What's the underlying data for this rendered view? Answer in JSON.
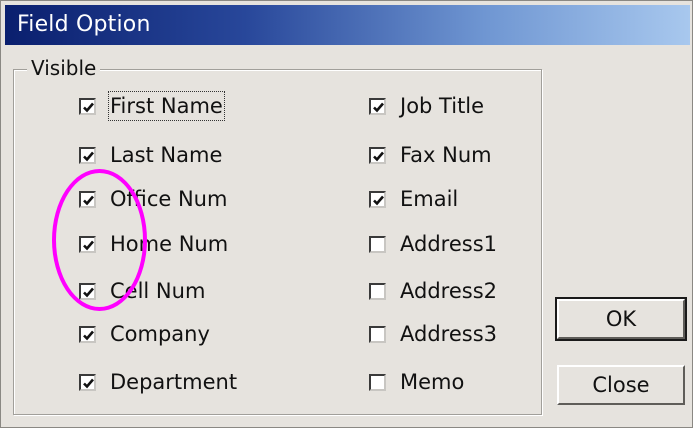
{
  "window": {
    "title": "Field Option"
  },
  "group": {
    "label": "Visible"
  },
  "left_column": [
    {
      "label": "First Name",
      "checked": true
    },
    {
      "label": "Last Name",
      "checked": true
    },
    {
      "label": "Office Num",
      "checked": true
    },
    {
      "label": "Home Num",
      "checked": true
    },
    {
      "label": "Cell Num",
      "checked": true
    },
    {
      "label": "Company",
      "checked": true
    },
    {
      "label": "Department",
      "checked": true
    }
  ],
  "right_column": [
    {
      "label": "Job Title",
      "checked": true
    },
    {
      "label": "Fax Num",
      "checked": true
    },
    {
      "label": "Email",
      "checked": true
    },
    {
      "label": "Address1",
      "checked": false
    },
    {
      "label": "Address2",
      "checked": false
    },
    {
      "label": "Address3",
      "checked": false
    },
    {
      "label": "Memo",
      "checked": false
    }
  ],
  "buttons": {
    "ok": "OK",
    "close": "Close"
  },
  "colors": {
    "annotation": "#ff00ff",
    "title_bar_start": "#0a1f6e",
    "title_bar_end": "#a8c8ee"
  }
}
